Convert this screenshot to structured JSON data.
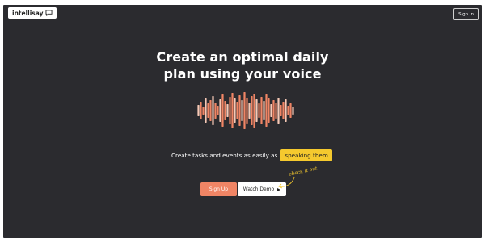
{
  "header": {
    "logo_text": "intellisay",
    "logo_icon": "chat-bubble-icon",
    "signin_label": "Sign In"
  },
  "hero": {
    "headline_line1": "Create an optimal daily",
    "headline_line2": "plan using your voice",
    "tagline": "Create tasks and events as easily as",
    "tagline_highlight": "speaking them",
    "annotation": "check it out"
  },
  "actions": {
    "signup_label": "Sign Up",
    "demo_label": "Watch Demo",
    "demo_icon": "play-icon"
  },
  "colors": {
    "background": "#2b2b2f",
    "accent_orange": "#f08565",
    "accent_yellow": "#f5c92e",
    "wave_light": "#f7c9b6",
    "wave_dark": "#f08565"
  }
}
